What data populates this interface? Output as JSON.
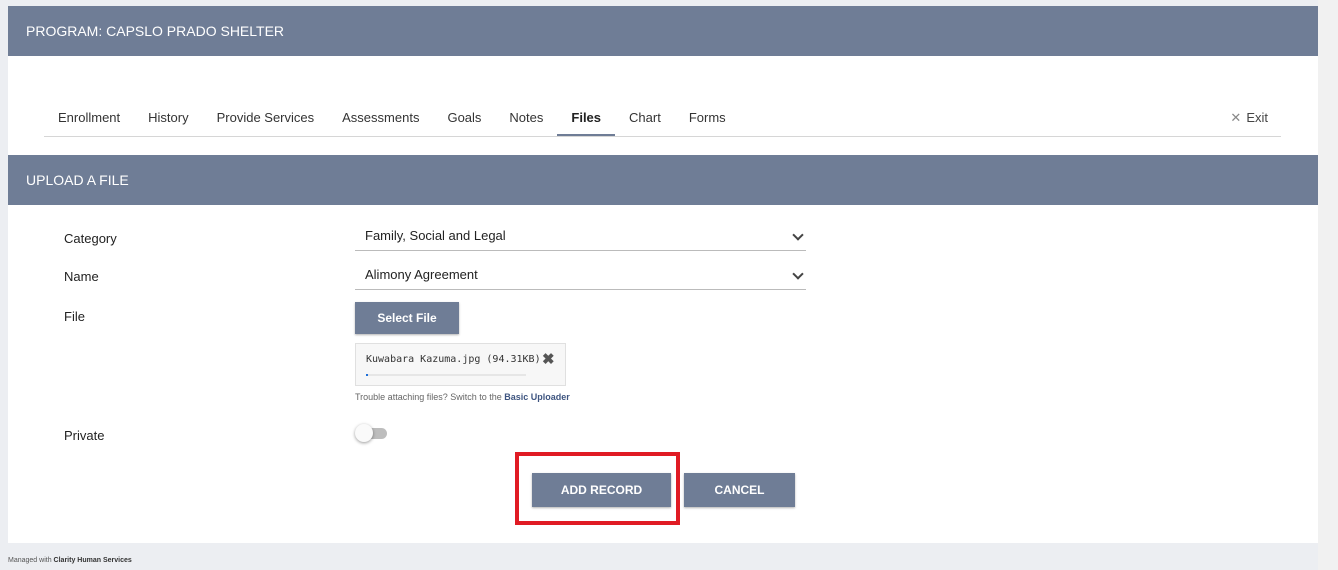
{
  "header": {
    "title": "PROGRAM: CAPSLO PRADO SHELTER"
  },
  "tabs": [
    {
      "label": "Enrollment",
      "active": false
    },
    {
      "label": "History",
      "active": false
    },
    {
      "label": "Provide Services",
      "active": false
    },
    {
      "label": "Assessments",
      "active": false
    },
    {
      "label": "Goals",
      "active": false
    },
    {
      "label": "Notes",
      "active": false
    },
    {
      "label": "Files",
      "active": true
    },
    {
      "label": "Chart",
      "active": false
    },
    {
      "label": "Forms",
      "active": false
    }
  ],
  "exit": {
    "icon": "close-icon",
    "symbol": "✕",
    "label": "Exit"
  },
  "section": {
    "title": "UPLOAD A FILE"
  },
  "form": {
    "category": {
      "label": "Category",
      "value": "Family, Social and Legal"
    },
    "name": {
      "label": "Name",
      "value": "Alimony Agreement"
    },
    "file": {
      "label": "File",
      "select_button": "Select File",
      "attached_file": "Kuwabara Kazuma.jpg (94.31KB)",
      "remove_symbol": "✖",
      "upload_progress": 0.01
    },
    "trouble": {
      "text": "Trouble attaching files? Switch to the",
      "link": "Basic Uploader"
    },
    "private": {
      "label": "Private",
      "on": false
    }
  },
  "actions": {
    "add_record": "ADD RECORD",
    "cancel": "CANCEL"
  },
  "colors": {
    "accent": "#6f7d96",
    "highlight": "#e01b24"
  },
  "footer": {
    "prefix": "Managed with",
    "brand": "Clarity Human Services"
  }
}
